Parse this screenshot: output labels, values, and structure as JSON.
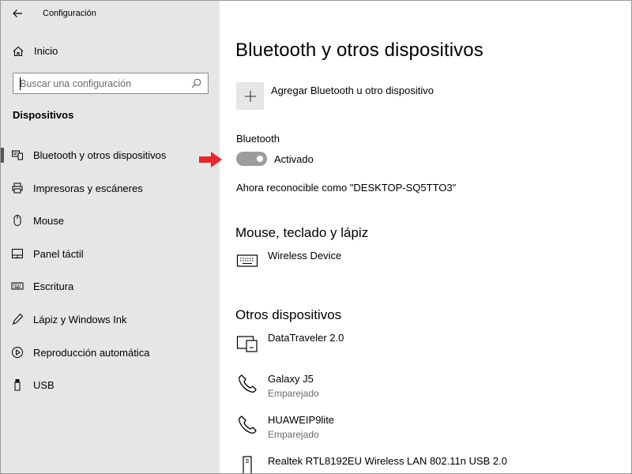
{
  "window": {
    "title": "Configuración"
  },
  "sidebar": {
    "home_label": "Inicio",
    "search": {
      "placeholder": "Buscar una configuración",
      "value": ""
    },
    "section_title": "Dispositivos",
    "items": [
      {
        "label": "Bluetooth y otros dispositivos",
        "icon": "bluetooth-devices-icon",
        "selected": true
      },
      {
        "label": "Impresoras y escáneres",
        "icon": "printer-icon",
        "selected": false
      },
      {
        "label": "Mouse",
        "icon": "mouse-icon",
        "selected": false
      },
      {
        "label": "Panel táctil",
        "icon": "touchpad-icon",
        "selected": false
      },
      {
        "label": "Escritura",
        "icon": "keyboard-icon",
        "selected": false
      },
      {
        "label": "Lápiz y Windows Ink",
        "icon": "pen-icon",
        "selected": false
      },
      {
        "label": "Reproducción automática",
        "icon": "autoplay-icon",
        "selected": false
      },
      {
        "label": "USB",
        "icon": "usb-icon",
        "selected": false
      }
    ]
  },
  "main": {
    "title": "Bluetooth y otros dispositivos",
    "add_device_label": "Agregar Bluetooth u otro dispositivo",
    "bluetooth": {
      "label": "Bluetooth",
      "toggle_state": "Activado",
      "discoverable_text": "Ahora reconocible como \"DESKTOP-SQ5TTO3\""
    },
    "mouse_group": {
      "title": "Mouse, teclado y lápiz",
      "devices": [
        {
          "name": "Wireless Device",
          "status": "",
          "icon": "keyboard-icon"
        }
      ]
    },
    "other_group": {
      "title": "Otros dispositivos",
      "devices": [
        {
          "name": "DataTraveler 2.0",
          "status": "",
          "icon": "drive-icon"
        },
        {
          "name": "Galaxy J5",
          "status": "Emparejado",
          "icon": "phone-icon"
        },
        {
          "name": "HUAWEIP9lite",
          "status": "Emparejado",
          "icon": "phone-icon"
        },
        {
          "name": "Realtek RTL8192EU Wireless LAN 802.11n USB 2.0",
          "status": "",
          "icon": "usb-adapter-icon"
        }
      ]
    }
  },
  "colors": {
    "sidebar_bg": "#e6e6e6",
    "toggle_off": "#9c9c9c",
    "annotation_arrow": "#e8262a"
  }
}
